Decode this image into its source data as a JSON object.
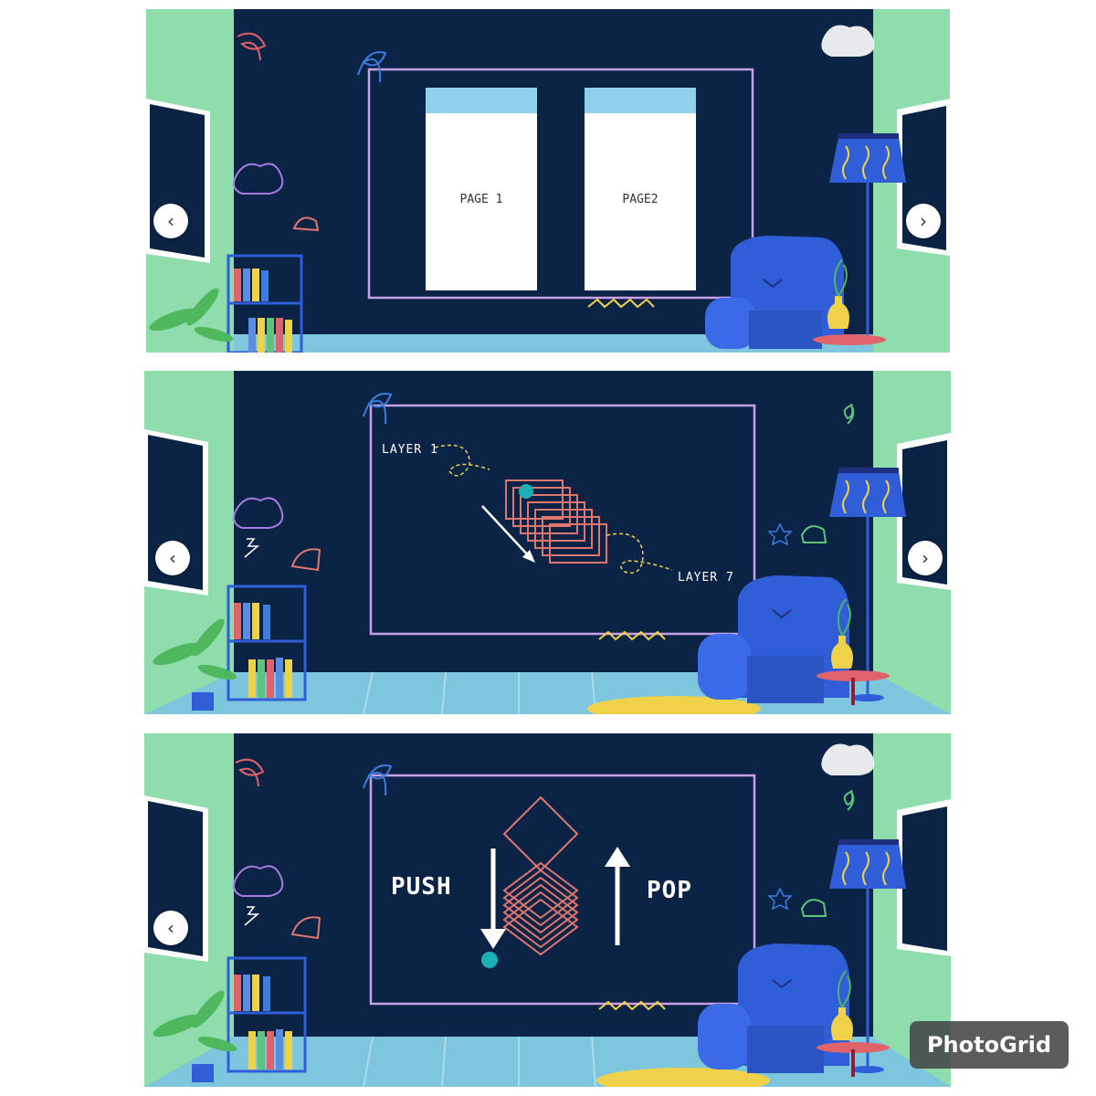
{
  "panels": [
    {
      "pages": [
        {
          "label": "PAGE 1"
        },
        {
          "label": "PAGE2"
        }
      ],
      "nav": {
        "prev": "‹",
        "next": "›"
      }
    },
    {
      "layer_first": "LAYER 1",
      "layer_last": "LAYER 7",
      "nav": {
        "prev": "‹",
        "next": "›"
      }
    },
    {
      "push_label": "PUSH",
      "pop_label": "POP",
      "nav": {
        "prev": "‹"
      }
    }
  ],
  "watermark": "PhotoGrid",
  "colors": {
    "chalkboard": "#0b2345",
    "wall": "#8fdcac",
    "board_outline": "#c9a0e8",
    "floor": "#7ec6de",
    "armchair": "#2f5ed8",
    "stack_lines": "#e07670",
    "cursor_dot": "#1ab0b6"
  }
}
